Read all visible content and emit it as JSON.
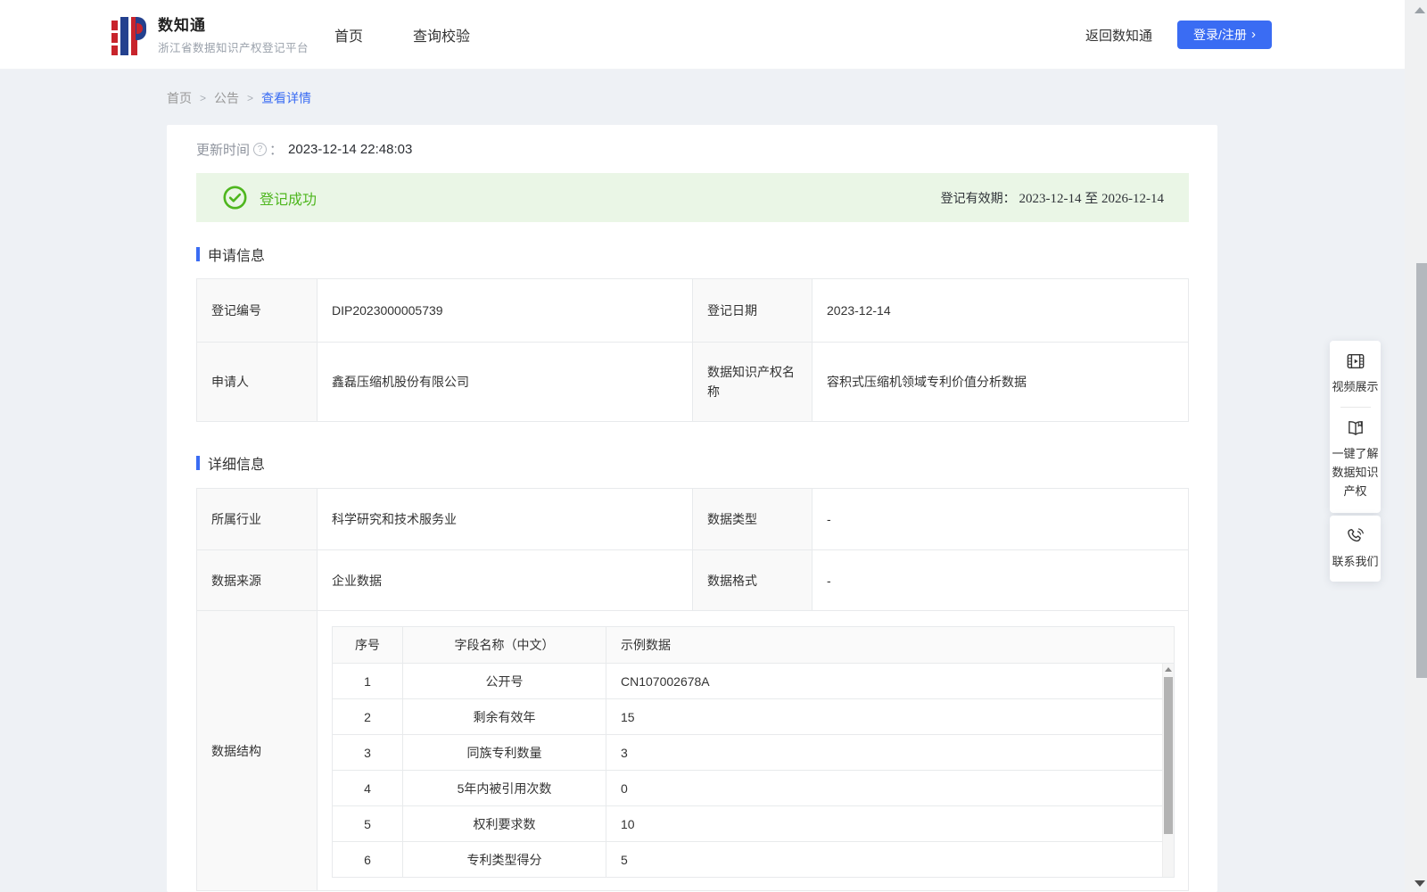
{
  "brand": {
    "name": "数知通",
    "subtitle": "浙江省数据知识产权登记平台"
  },
  "nav": {
    "items": [
      {
        "label": "首页"
      },
      {
        "label": "查询校验"
      }
    ],
    "back_link": "返回数知通",
    "login_button": "登录/注册"
  },
  "icons": {
    "chevron_right": "›",
    "help": "?"
  },
  "breadcrumb": {
    "items": [
      "首页",
      "公告",
      "查看详情"
    ],
    "separator": ">"
  },
  "meta": {
    "update_time_label": "更新时间",
    "colon": "：",
    "update_time_value": "2023-12-14 22:48:03"
  },
  "status_banner": {
    "status_text": "登记成功",
    "validity_label": "登记有效期：",
    "validity_value": "2023-12-14 至 2026-12-14"
  },
  "sections": {
    "application": "申请信息",
    "detail": "详细信息"
  },
  "application_info": {
    "rows": [
      {
        "label1": "登记编号",
        "value1": "DIP2023000005739",
        "label2": "登记日期",
        "value2": "2023-12-14"
      },
      {
        "label1": "申请人",
        "value1": "鑫磊压缩机股份有限公司",
        "label2": "数据知识产权名称",
        "value2": "容积式压缩机领域专利价值分析数据"
      }
    ]
  },
  "detail_info": {
    "rows": [
      {
        "label1": "所属行业",
        "value1": "科学研究和技术服务业",
        "label2": "数据类型",
        "value2": "-"
      },
      {
        "label1": "数据来源",
        "value1": "企业数据",
        "label2": "数据格式",
        "value2": "-"
      }
    ],
    "structure_label": "数据结构",
    "structure_table": {
      "headers": [
        "序号",
        "字段名称（中文）",
        "示例数据"
      ],
      "rows": [
        [
          "1",
          "公开号",
          "CN107002678A"
        ],
        [
          "2",
          "剩余有效年",
          "15"
        ],
        [
          "3",
          "同族专利数量",
          "3"
        ],
        [
          "4",
          "5年内被引用次数",
          "0"
        ],
        [
          "5",
          "权利要求数",
          "10"
        ],
        [
          "6",
          "专利类型得分",
          "5"
        ]
      ]
    }
  },
  "floating_panel": {
    "video": "视频展示",
    "guide": "一键了解数据知识产权",
    "contact": "联系我们"
  },
  "colors": {
    "accent": "#3a6cf3",
    "success": "#4eb61e",
    "success_bg": "#eaf6e6"
  }
}
